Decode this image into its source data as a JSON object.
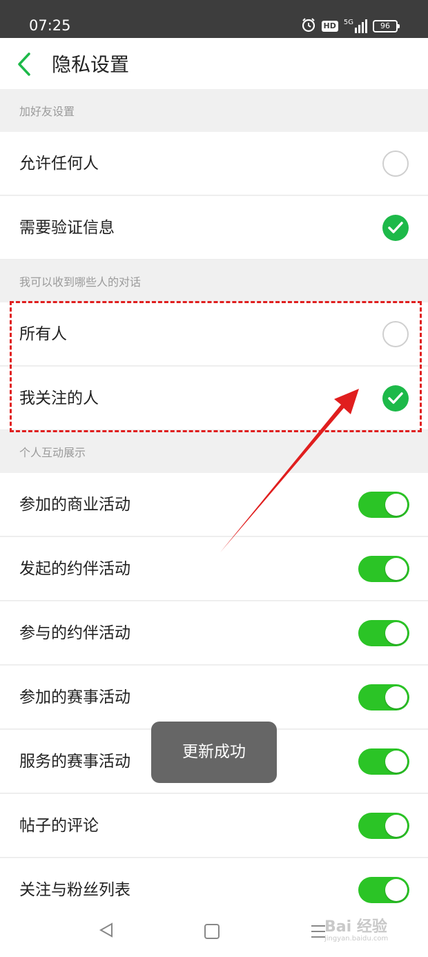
{
  "status_bar": {
    "time": "07:25",
    "network": "5G",
    "hd": "HD",
    "battery": "96"
  },
  "header": {
    "title": "隐私设置"
  },
  "sections": {
    "add_friend": {
      "title": "加好友设置",
      "options": [
        {
          "label": "允许任何人",
          "selected": false
        },
        {
          "label": "需要验证信息",
          "selected": true
        }
      ]
    },
    "conversations": {
      "title": "我可以收到哪些人的对话",
      "options": [
        {
          "label": "所有人",
          "selected": false
        },
        {
          "label": "我关注的人",
          "selected": true
        }
      ]
    },
    "interactions": {
      "title": "个人互动展示",
      "toggles": [
        {
          "label": "参加的商业活动",
          "on": true
        },
        {
          "label": "发起的约伴活动",
          "on": true
        },
        {
          "label": "参与的约伴活动",
          "on": true
        },
        {
          "label": "参加的赛事活动",
          "on": true
        },
        {
          "label": "服务的赛事活动",
          "on": true
        },
        {
          "label": "帖子的评论",
          "on": true
        },
        {
          "label": "关注与粉丝列表",
          "on": true
        }
      ]
    }
  },
  "toast": {
    "text": "更新成功"
  },
  "watermark": {
    "brand": "Bai 经验",
    "url": "jingyan.baidu.com"
  },
  "colors": {
    "accent": "#1db949",
    "toggle": "#2bc426",
    "highlight": "#e01e1e"
  }
}
